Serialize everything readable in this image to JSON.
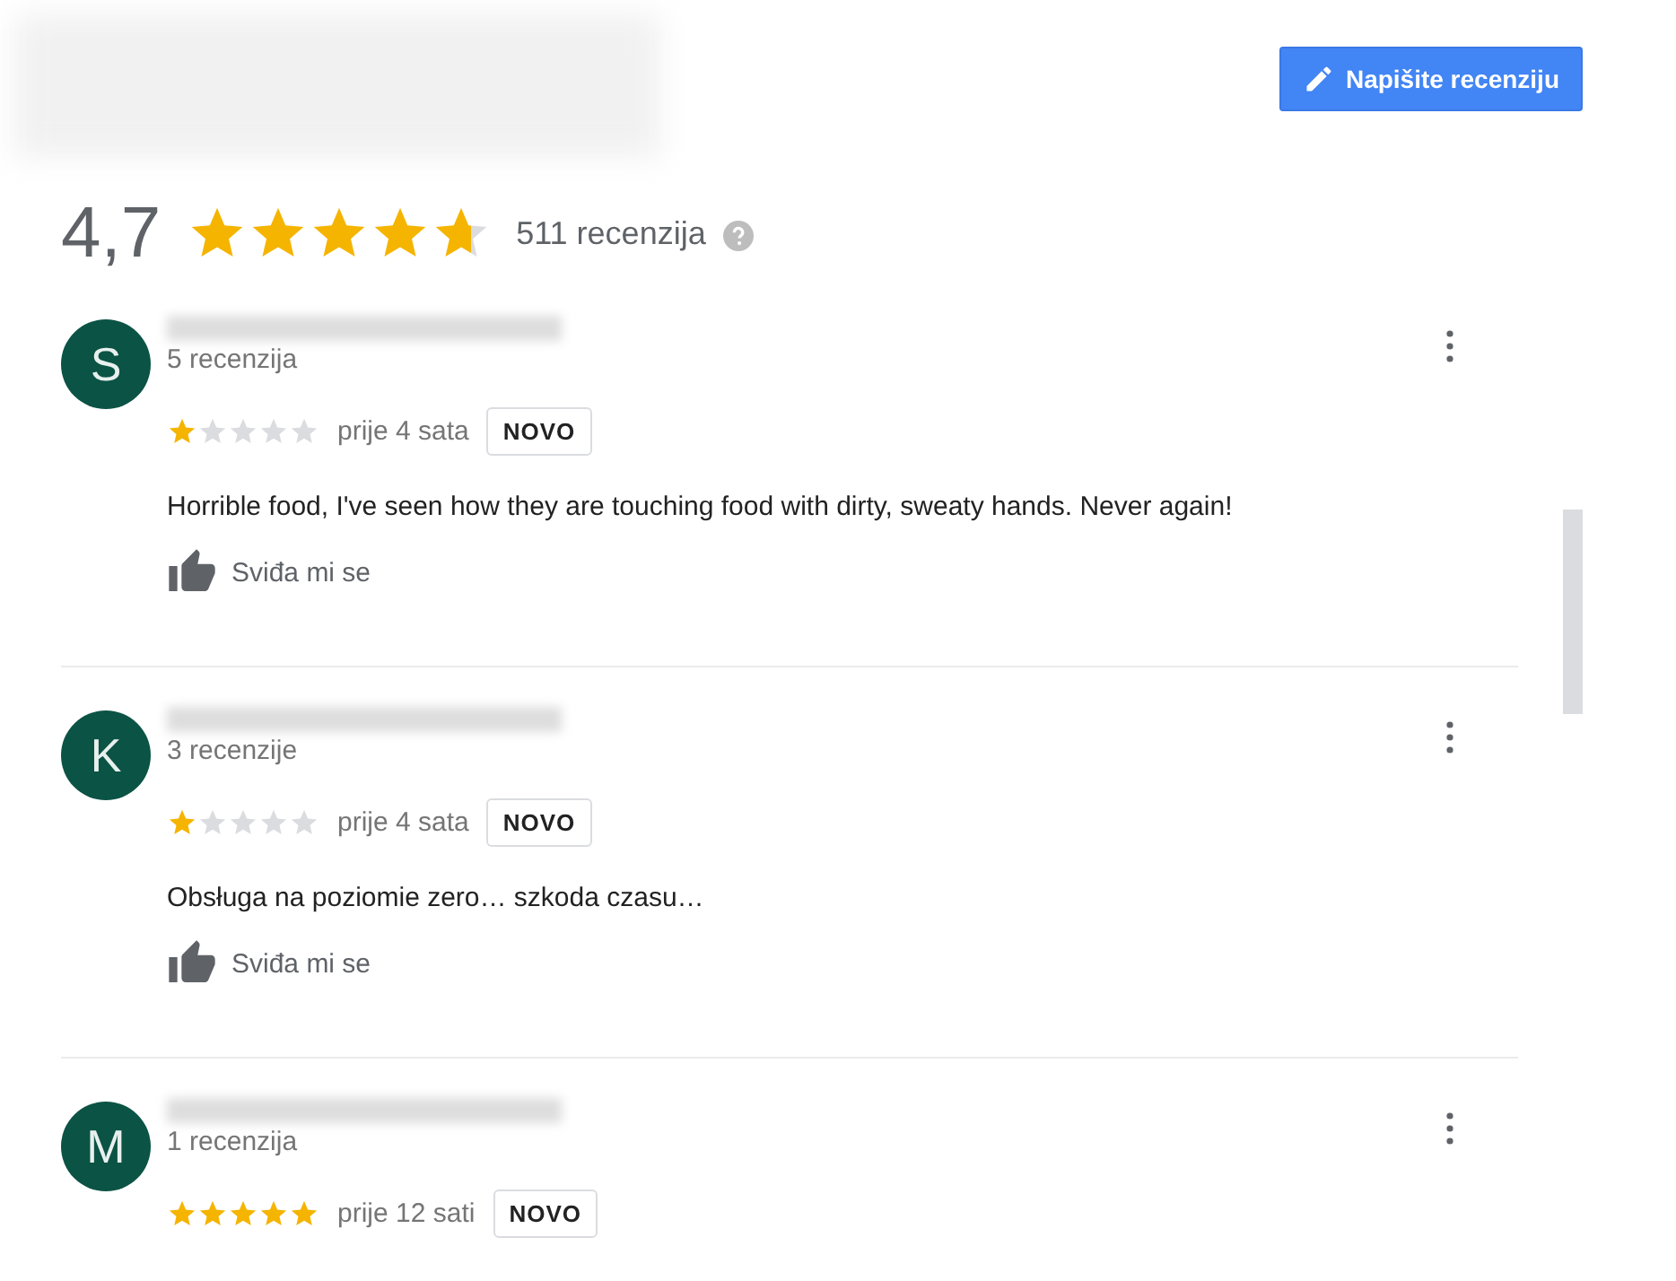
{
  "write_button": {
    "label": "Napišite recenziju"
  },
  "summary": {
    "rating": "4,7",
    "stars": 4.7,
    "count": "511 recenzija"
  },
  "reviews": [
    {
      "initial": "S",
      "review_count": "5 recenzija",
      "stars": 1,
      "time": "prije 4 sata",
      "badge": "NOVO",
      "text": "Horrible food, I've seen how they are touching food with dirty, sweaty hands. Never again!",
      "like": "Sviđa mi se"
    },
    {
      "initial": "K",
      "review_count": "3 recenzije",
      "stars": 1,
      "time": "prije 4 sata",
      "badge": "NOVO",
      "text": "Obsługa na poziomie zero… szkoda czasu…",
      "like": "Sviđa mi se"
    },
    {
      "initial": "M",
      "review_count": "1 recenzija",
      "stars": 5,
      "time": "prije 12 sati",
      "badge": "NOVO"
    }
  ]
}
